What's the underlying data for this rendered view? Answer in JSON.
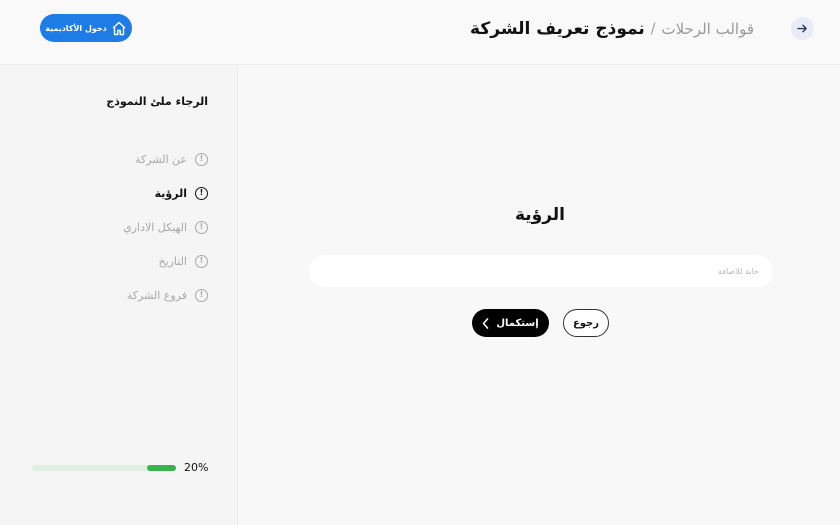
{
  "header": {
    "breadcrumb_link": "قوالب الرحلات",
    "separator": "/",
    "title": "نموذج تعريف الشركة",
    "academy_button": "دخول الأكاديمية",
    "back_icon": "arrow-right-icon",
    "academy_icon": "home-icon"
  },
  "sidebar": {
    "title": "الرجاء ملئ النموذج",
    "steps": [
      {
        "label": "عن الشركة",
        "active": false
      },
      {
        "label": "الرؤية",
        "active": true
      },
      {
        "label": "الهيكل الاداري",
        "active": false
      },
      {
        "label": "التاريخ",
        "active": false
      },
      {
        "label": "فروع الشركة",
        "active": false
      }
    ],
    "progress": {
      "value": 20,
      "text": "20%",
      "color": "#38b54a"
    }
  },
  "main": {
    "title": "الرؤية",
    "field_placeholder": "خانة للاضافة",
    "field_value": "",
    "back_button": "رجوع",
    "continue_button": "إستكمال"
  },
  "colors": {
    "accent": "#1d7ce6",
    "primary_button": "#000000",
    "progress": "#38b54a"
  }
}
